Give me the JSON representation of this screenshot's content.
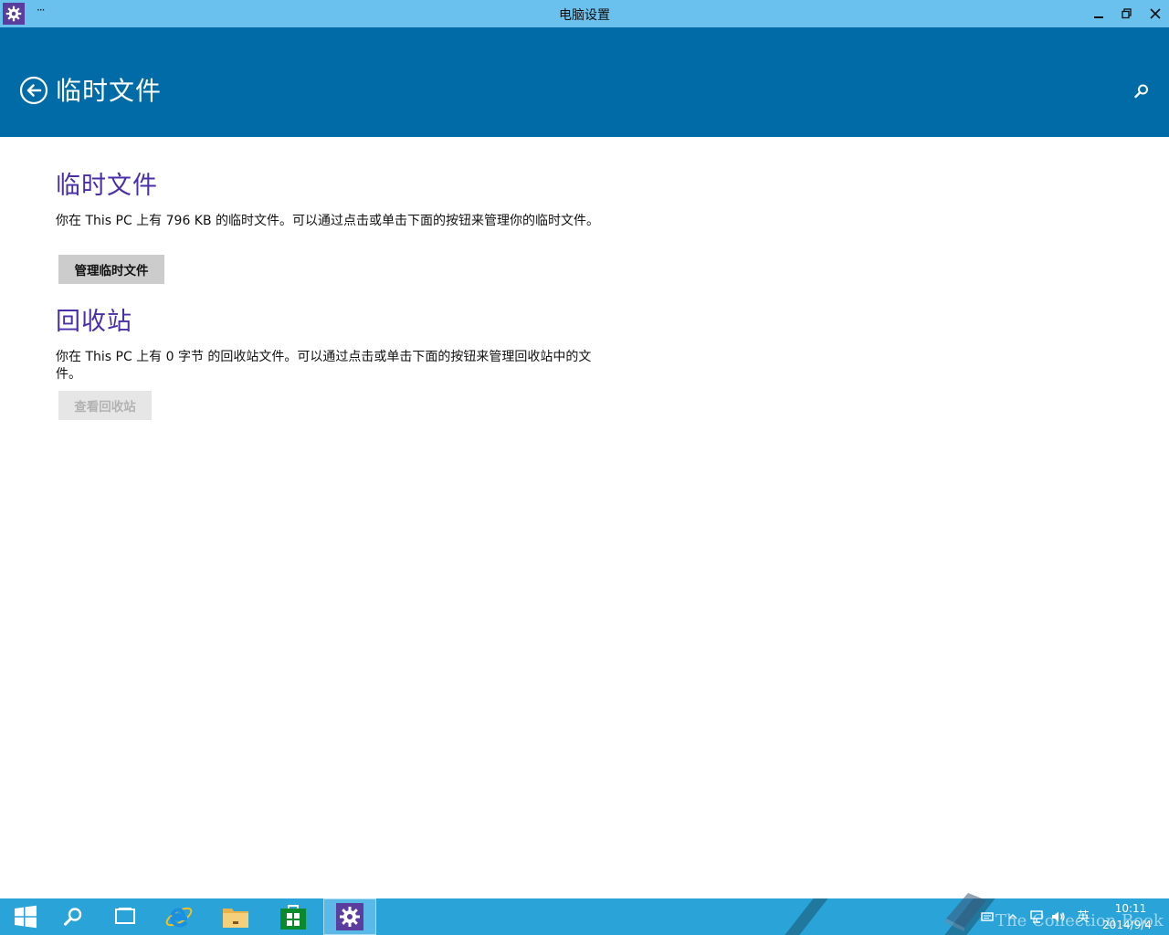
{
  "window": {
    "title": "电脑设置",
    "menu_glyph": "···",
    "controls": {
      "minimize": "minimize",
      "maximize": "restore",
      "close": "close"
    }
  },
  "header": {
    "title": "临时文件",
    "back_icon": "back-arrow-icon",
    "search_icon": "search-icon"
  },
  "sections": [
    {
      "title": "临时文件",
      "description": "你在 This PC 上有 796 KB 的临时文件。可以通过点击或单击下面的按钮来管理你的临时文件。",
      "button_label": "管理临时文件",
      "button_enabled": true
    },
    {
      "title": "回收站",
      "description": "你在 This PC 上有 0 字节 的回收站文件。可以通过点击或单击下面的按钮来管理回收站中的文件。",
      "button_label": "查看回收站",
      "button_enabled": false
    }
  ],
  "taskbar": {
    "items": [
      "start-icon",
      "search-icon",
      "task-view-icon",
      "internet-explorer-icon",
      "file-explorer-icon",
      "store-icon",
      "settings-icon"
    ],
    "active": "settings-icon",
    "tray": {
      "ime_label": "英",
      "time": "10:11",
      "date": "2014/9/4"
    }
  },
  "watermark": {
    "text": "The Collection Book"
  },
  "colors": {
    "titlebar": "#6ac1ee",
    "header": "#006ba6",
    "section_title": "#4a2fa8",
    "taskbar": "#2aa3d8",
    "app_icon": "#5a3d9e"
  }
}
